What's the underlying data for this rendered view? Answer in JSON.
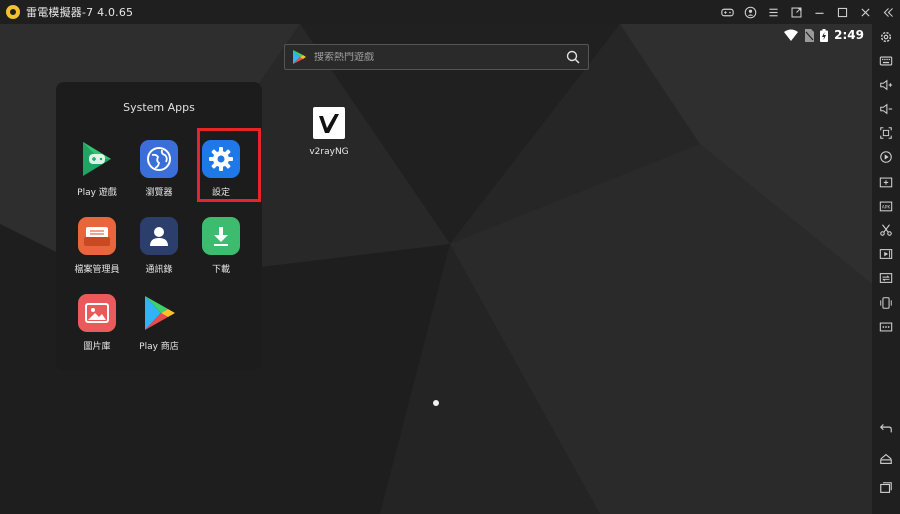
{
  "window": {
    "title": "雷電模擬器-7 4.0.65"
  },
  "status": {
    "time": "2:49"
  },
  "search": {
    "placeholder": "搜索熱門遊戲"
  },
  "desktop": {
    "apps": [
      {
        "label": "v2rayNG",
        "icon": "v2rayng-icon"
      }
    ]
  },
  "folder": {
    "title": "System Apps",
    "apps": [
      {
        "label": "Play 遊戲",
        "icon": "play-games-icon"
      },
      {
        "label": "瀏覽器",
        "icon": "browser-icon"
      },
      {
        "label": "設定",
        "icon": "settings-gear-icon",
        "highlighted": true
      },
      {
        "label": "檔案管理員",
        "icon": "file-manager-icon"
      },
      {
        "label": "通訊錄",
        "icon": "contacts-icon"
      },
      {
        "label": "下載",
        "icon": "download-icon"
      },
      {
        "label": "圖片庫",
        "icon": "gallery-icon"
      },
      {
        "label": "Play 商店",
        "icon": "play-store-icon"
      }
    ]
  },
  "colors": {
    "highlight_border": "#e5252a",
    "settings_blue": "#1e78e8",
    "browser_blue": "#3a6fd9",
    "file_orange": "#e9663c",
    "contacts_navy": "#2c3e6b",
    "download_green": "#3dbb6e",
    "gallery_red": "#ea5a5a"
  },
  "icons": {
    "titlebar": [
      "gamepad-icon",
      "account-icon",
      "menu-icon",
      "external-window-icon",
      "minimize-icon",
      "maximize-icon",
      "close-icon",
      "collapse-sidebar-icon"
    ],
    "sidebar": [
      "settings-icon",
      "keyboard-icon",
      "volume-up-icon",
      "volume-down-icon",
      "fullscreen-icon",
      "record-icon",
      "add-app-icon",
      "apk-icon",
      "scissors-icon",
      "video-icon",
      "sync-icon",
      "shake-icon",
      "more-icon",
      "back-icon",
      "home-icon",
      "recent-apps-icon"
    ]
  }
}
